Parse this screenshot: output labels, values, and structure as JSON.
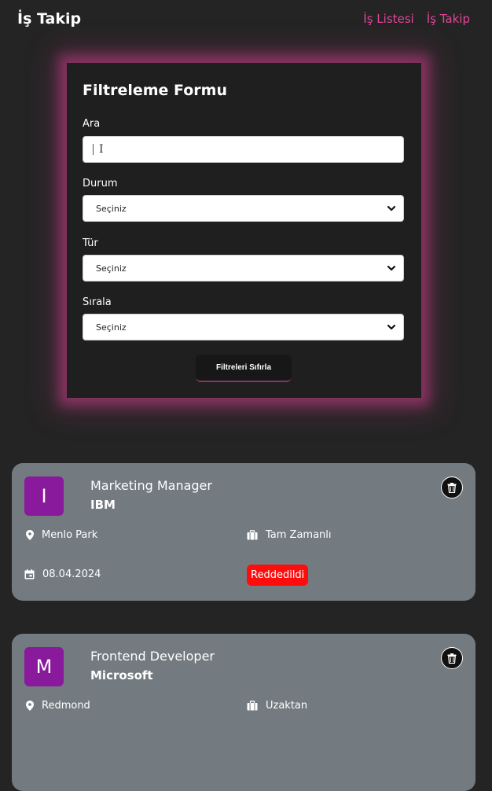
{
  "header": {
    "brand": "İş Takip",
    "nav": [
      "İş Listesi",
      "İş Takip"
    ]
  },
  "filter": {
    "title": "Filtreleme Formu",
    "search_label": "Ara",
    "search_value": "",
    "status_label": "Durum",
    "status_value": "Seçiniz",
    "type_label": "Tür",
    "type_value": "Seçiniz",
    "sort_label": "Sırala",
    "sort_value": "Seçiniz",
    "reset_label": "Filtreleri Sıfırla"
  },
  "jobs": [
    {
      "initial": "I",
      "title": "Marketing Manager",
      "company": "IBM",
      "location": "Menlo Park",
      "type": "Tam Zamanlı",
      "date": "08.04.2024",
      "status": "Reddedildi"
    },
    {
      "initial": "M",
      "title": "Frontend Developer",
      "company": "Microsoft",
      "location": "Redmond",
      "type": "Uzaktan"
    }
  ],
  "colors": {
    "accent": "#e0469a",
    "card": "#737b80",
    "avatar": "#8a1a9c",
    "status_rejected": "#ff0d0d"
  }
}
